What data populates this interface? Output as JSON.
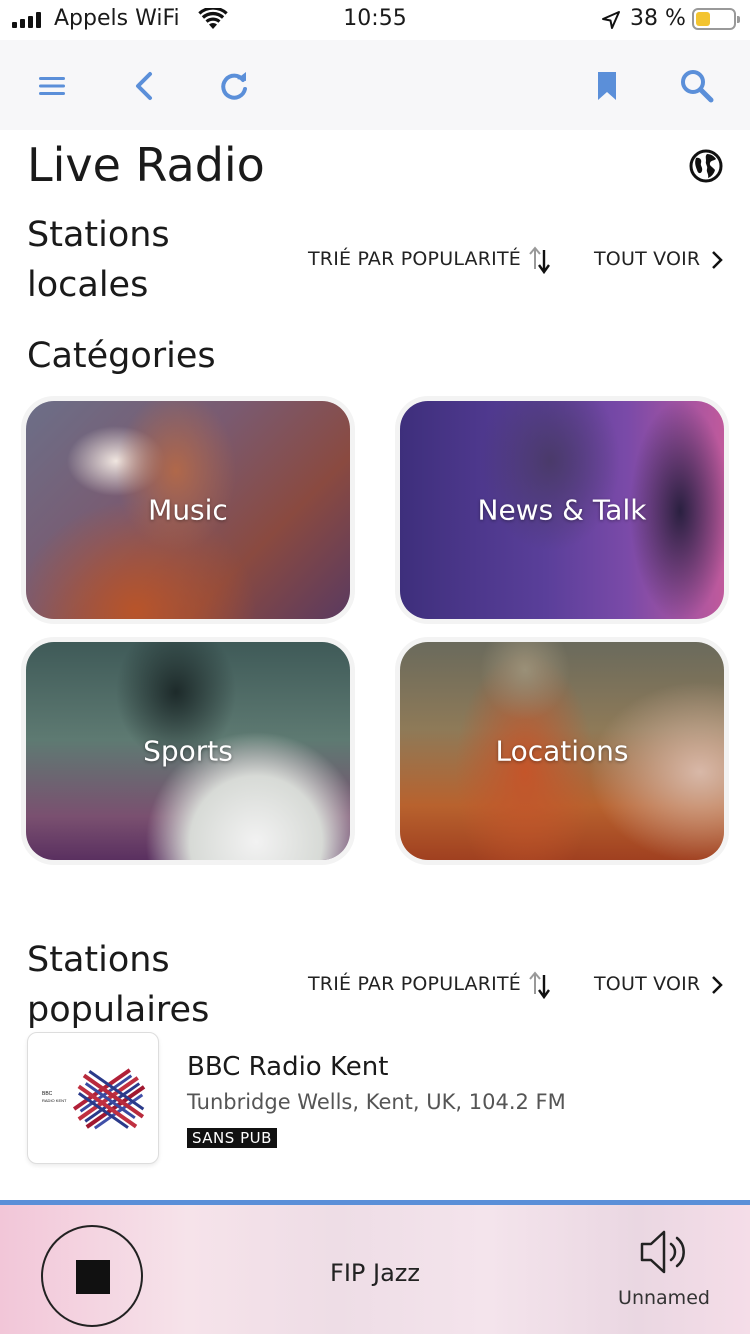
{
  "status_bar": {
    "carrier": "Appels WiFi",
    "time": "10:55",
    "battery_percent": "38 %",
    "battery_level": 0.38
  },
  "nav": {
    "icons": [
      "menu-icon",
      "back-icon",
      "refresh-icon",
      "bookmark-icon",
      "search-icon"
    ],
    "accent_color": "#5b8fd9"
  },
  "page": {
    "title": "Live Radio"
  },
  "local_stations": {
    "title_line1": "Stations",
    "title_line2": "locales",
    "sort_label": "TRIÉ PAR POPULARITÉ",
    "see_all_label": "TOUT VOIR"
  },
  "categories": {
    "title": "Catégories",
    "items": [
      {
        "label": "Music"
      },
      {
        "label": "News & Talk"
      },
      {
        "label": "Sports"
      },
      {
        "label": "Locations"
      }
    ]
  },
  "popular_stations": {
    "title_line1": "Stations",
    "title_line2": "populaires",
    "sort_label": "TRIÉ PAR POPULARITÉ",
    "see_all_label": "TOUT VOIR",
    "items": [
      {
        "name": "BBC Radio Kent",
        "location": "Tunbridge Wells, Kent, UK, 104.2 FM",
        "badge": "SANS PUB",
        "logo_text": "BBC RADIO KENT"
      }
    ]
  },
  "player": {
    "now_playing": "FIP Jazz",
    "device": "Unnamed"
  }
}
